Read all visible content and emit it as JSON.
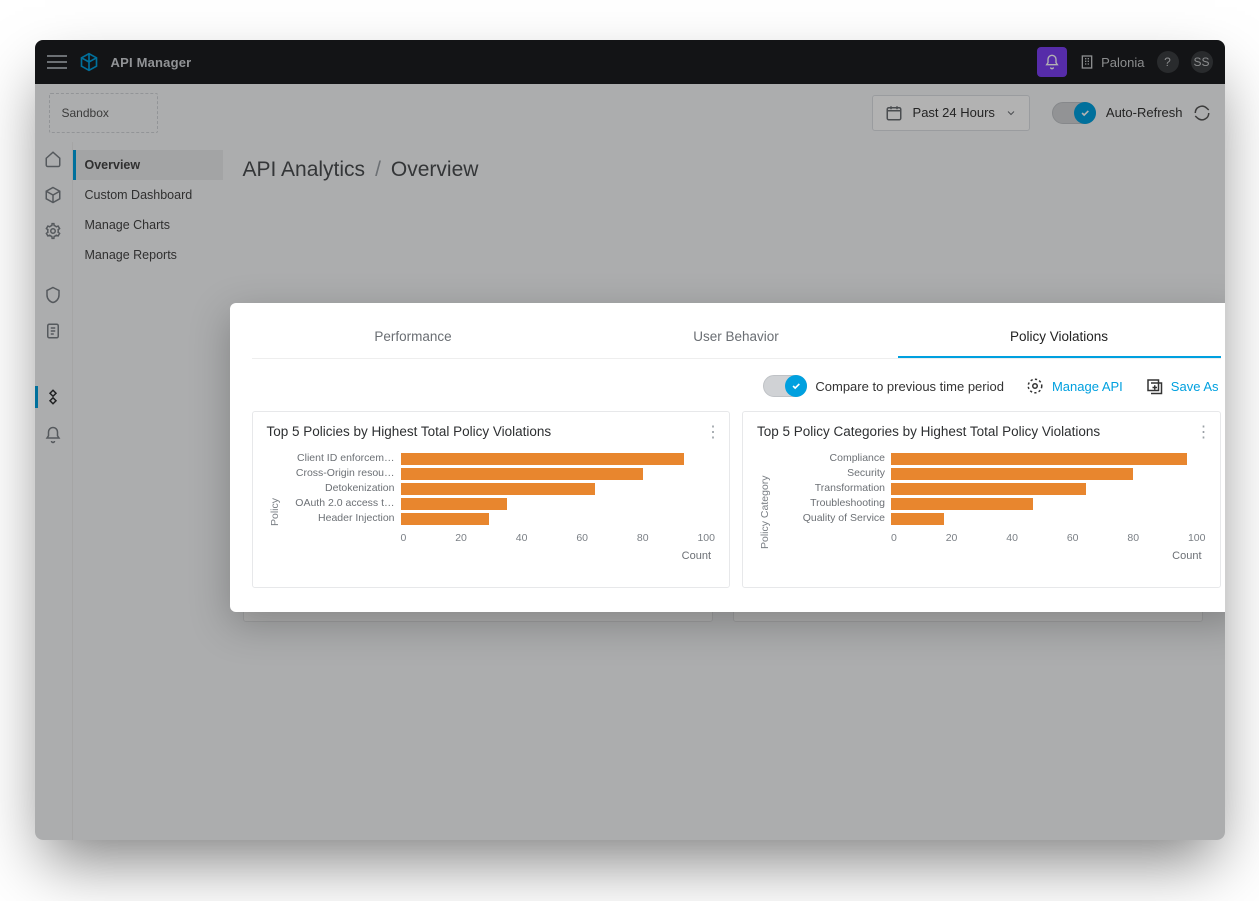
{
  "header": {
    "app_title": "API Manager",
    "org_name": "Palonia",
    "help_label": "?",
    "user_initials": "SS"
  },
  "toolbar": {
    "environment": "Sandbox",
    "time_range": "Past 24 Hours",
    "auto_refresh_label": "Auto-Refresh"
  },
  "sidebar": {
    "items": [
      "Overview",
      "Custom Dashboard",
      "Manage Charts",
      "Manage Reports"
    ],
    "active_index": 0
  },
  "breadcrumb": {
    "section": "API Analytics",
    "page": "Overview"
  },
  "panel": {
    "tabs": [
      "Performance",
      "User Behavior",
      "Policy Violations"
    ],
    "active_tab_index": 2,
    "compare_label": "Compare to previous time period",
    "manage_api_label": "Manage API",
    "save_as_label": "Save As"
  },
  "cards": [
    {
      "title": "Top 5 Policies by Highest Total Policy Violations"
    },
    {
      "title": "Top 5 Policy Categories by Highest Total Policy Violations"
    }
  ],
  "chart_data": [
    {
      "type": "bar",
      "orientation": "horizontal",
      "title": "Top 5 Policies by Highest Total Policy Violations",
      "ylabel": "Policy",
      "xlabel": "Count",
      "xlim": [
        0,
        100
      ],
      "xticks": [
        0,
        20,
        40,
        60,
        80,
        100
      ],
      "categories": [
        "Client ID enforcem…",
        "Cross-Origin resou…",
        "Detokenization",
        "OAuth 2.0 access t…",
        "Header Injection"
      ],
      "values": [
        90,
        77,
        62,
        34,
        28
      ]
    },
    {
      "type": "bar",
      "orientation": "horizontal",
      "title": "Top 5 Policy Categories by Highest Total Policy Violations",
      "ylabel": "Policy Category",
      "xlabel": "Count",
      "xlim": [
        0,
        100
      ],
      "xticks": [
        0,
        20,
        40,
        60,
        80,
        100
      ],
      "categories": [
        "Compliance",
        "Security",
        "Transformation",
        "Troubleshooting",
        "Quality of Service"
      ],
      "values": [
        94,
        77,
        62,
        45,
        17
      ]
    }
  ]
}
